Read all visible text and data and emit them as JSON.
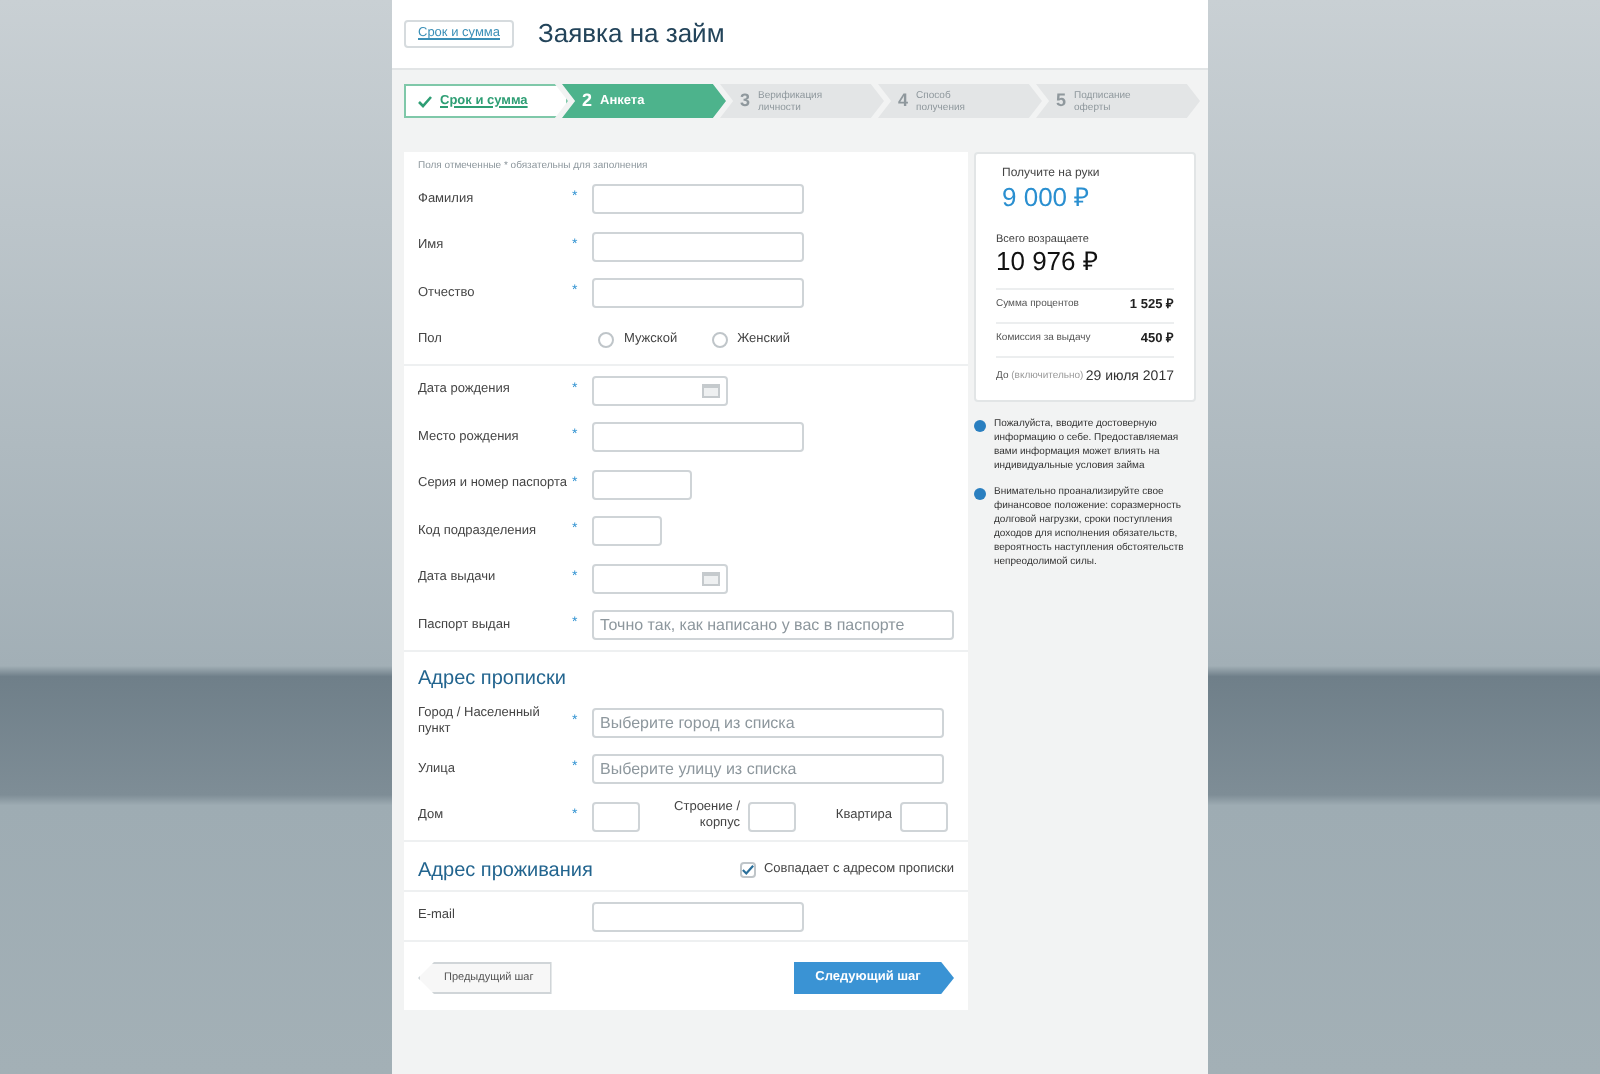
{
  "header": {
    "back_button": "Срок и сумма",
    "title": "Заявка на займ"
  },
  "steps": [
    {
      "label": "Срок и сумма",
      "completed": true,
      "selected": false
    },
    {
      "number": "2",
      "label": "Анкета",
      "completed": false,
      "selected": true
    },
    {
      "number": "3",
      "label": "Верификация личности",
      "completed": false,
      "selected": false
    },
    {
      "number": "4",
      "label": "Способ получения",
      "completed": false,
      "selected": false
    },
    {
      "number": "5",
      "label": "Подписание оферты",
      "completed": false,
      "selected": false
    }
  ],
  "form": {
    "note": "Поля отмеченные * обязательны для заполнения",
    "sections": [
      {
        "fields": [
          {
            "kind": "text",
            "label": "Фамилия",
            "mark": "*"
          },
          {
            "kind": "text",
            "label": "Имя",
            "mark": "*"
          },
          {
            "kind": "text",
            "label": "Отчество",
            "mark": "*"
          },
          {
            "kind": "radio",
            "label": "Пол",
            "options": [
              {
                "label": "Мужской",
                "selected": false
              },
              {
                "label": "Женский",
                "selected": false
              }
            ]
          }
        ]
      },
      {
        "fields": [
          {
            "kind": "date",
            "label": "Дата рождения",
            "mark": "*"
          },
          {
            "kind": "text",
            "label": "Место рождения",
            "mark": "*"
          },
          {
            "kind": "passport",
            "label": "Серия и номер паспорта",
            "mark": "*"
          },
          {
            "kind": "code",
            "label": "Код подразделения",
            "mark": "*"
          },
          {
            "kind": "date",
            "label": "Дата выдачи",
            "mark": "*"
          },
          {
            "kind": "wide",
            "label": "Паспорт выдан",
            "mark": "*",
            "placeholder": "Точно так, как написано у вас в паспорте"
          }
        ]
      },
      {
        "heading": "Адрес прописки",
        "fields": [
          {
            "kind": "select",
            "label": "Город / Населенный пункт",
            "mark": "*",
            "placeholder": "Выберите город из списка"
          },
          {
            "kind": "select",
            "label": "Улица",
            "mark": "*",
            "placeholder": "Выберите улицу из списка"
          },
          {
            "kind": "parts",
            "label": "Дом",
            "mark": "*",
            "parts": [
              {
                "label": "Строение / корпус"
              },
              {
                "label": "Квартира"
              }
            ]
          }
        ]
      },
      {
        "heading": "Адрес проживания",
        "checkbox": {
          "label": "Совпадает с адресом прописки",
          "checked": true
        }
      },
      {
        "fields": [
          {
            "kind": "text",
            "label": "E-mail"
          }
        ]
      }
    ]
  },
  "buttons": {
    "previous": "Предыдущий шаг",
    "next": "Следующий шаг"
  },
  "summary": {
    "receive_label": "Получите на руки",
    "receive_amount": "9 000",
    "currency": "₽",
    "return_label": "Всего возращаете",
    "return_amount": "10 976",
    "rows": [
      {
        "label": "Сумма процентов",
        "value": "1 525 ₽"
      },
      {
        "label": "Комиссия за выдачу",
        "value": "450 ₽"
      }
    ],
    "due_label": "До",
    "due_note": "(включительно)",
    "due_date": "29 июля 2017"
  },
  "notes": [
    "Пожалуйста, вводите достоверную информацию о себе. Предоставляемая вами информация может влиять на индивидуальные условия займа",
    "Внимательно проанализируйте свое финансовое положение: соразмерность долговой нагрузки, сроки поступления доходов для исполнения обязательств, вероятность наступления обстоятельств непреодолимой силы."
  ]
}
